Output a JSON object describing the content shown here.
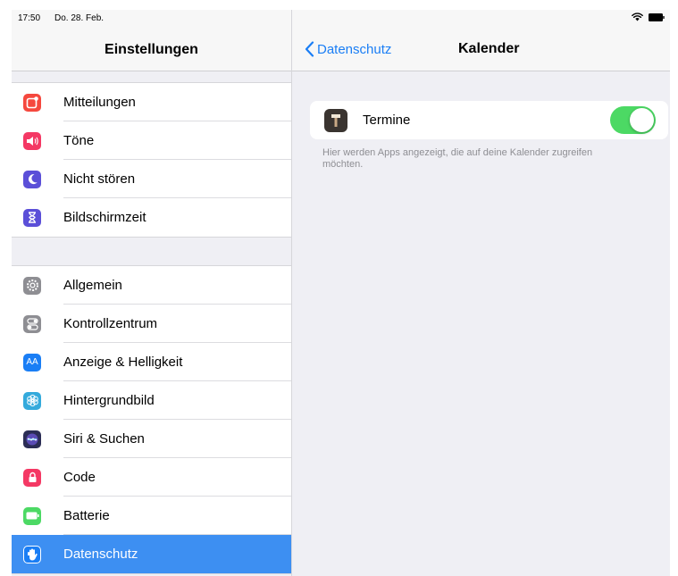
{
  "status_bar": {
    "time": "17:50",
    "date": "Do. 28. Feb."
  },
  "sidebar": {
    "title": "Einstellungen",
    "group1": [
      {
        "label": "Mitteilungen",
        "icon": "notifications-icon",
        "color": "#f5483e"
      },
      {
        "label": "Töne",
        "icon": "sounds-icon",
        "color": "#f43864"
      },
      {
        "label": "Nicht stören",
        "icon": "moon-icon",
        "color": "#5b4fd8"
      },
      {
        "label": "Bildschirmzeit",
        "icon": "hourglass-icon",
        "color": "#5b4fd8"
      }
    ],
    "group2": [
      {
        "label": "Allgemein",
        "icon": "gear-icon",
        "color": "#8e8e93"
      },
      {
        "label": "Kontrollzentrum",
        "icon": "switches-icon",
        "color": "#8e8e93"
      },
      {
        "label": "Anzeige & Helligkeit",
        "icon": "display-icon",
        "color": "#1a7ef5",
        "glyph": "AA"
      },
      {
        "label": "Hintergrundbild",
        "icon": "wallpaper-icon",
        "color": "#34aadc"
      },
      {
        "label": "Siri & Suchen",
        "icon": "siri-icon",
        "color": "#2b2d55"
      },
      {
        "label": "Code",
        "icon": "lock-icon",
        "color": "#f43864"
      },
      {
        "label": "Batterie",
        "icon": "battery-icon",
        "color": "#4cd964"
      },
      {
        "label": "Datenschutz",
        "icon": "hand-icon",
        "color": "#1a7ef5",
        "selected": true
      }
    ]
  },
  "detail": {
    "back_label": "Datenschutz",
    "title": "Kalender",
    "app_row": {
      "label": "Termine",
      "icon": "termine-app-icon",
      "toggle_on": true,
      "toggle_color": "#4cd964"
    },
    "footnote": "Hier werden Apps angezeigt, die auf deine Kalender zugreifen möchten."
  },
  "accent": "#3d8ff2"
}
